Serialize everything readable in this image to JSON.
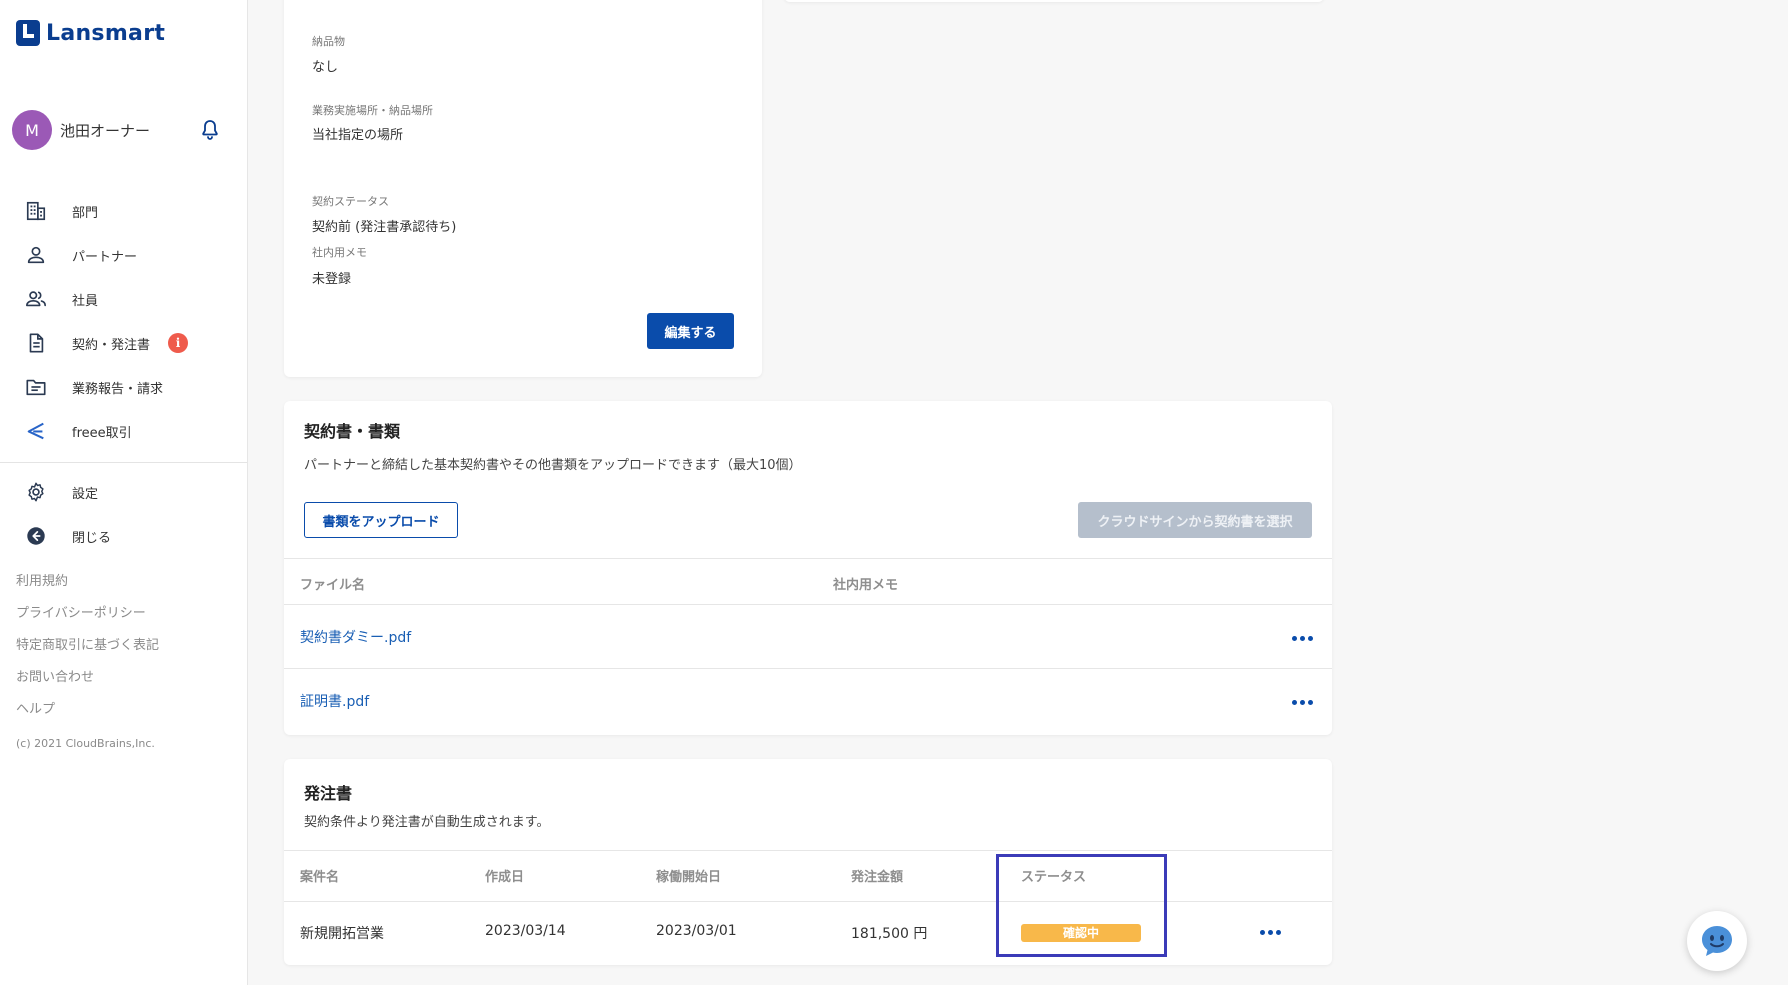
{
  "brand": {
    "name": "Lansmart",
    "color": "#0a3d8f"
  },
  "user": {
    "initial": "M",
    "name": "池田オーナー",
    "avatar_color": "#9b59b6"
  },
  "nav": {
    "items": [
      {
        "label": "部門",
        "icon": "building-icon"
      },
      {
        "label": "パートナー",
        "icon": "person-icon"
      },
      {
        "label": "社員",
        "icon": "people-icon"
      },
      {
        "label": "契約・発注書",
        "icon": "document-icon",
        "badge": "i"
      },
      {
        "label": "業務報告・請求",
        "icon": "folder-icon"
      },
      {
        "label": "freee取引",
        "icon": "freee-icon"
      }
    ],
    "secondary": [
      {
        "label": "設定",
        "icon": "gear-icon"
      },
      {
        "label": "閉じる",
        "icon": "arrow-left-circle-icon"
      }
    ]
  },
  "footer": {
    "links": [
      "利用規約",
      "プライバシーポリシー",
      "特定商取引に基づく表記",
      "お問い合わせ",
      "ヘルプ"
    ],
    "copyright": "(c) 2021 CloudBrains,Inc."
  },
  "contract_detail": {
    "deliverables_label": "納品物",
    "deliverables_value": "なし",
    "location_label": "業務実施場所・納品場所",
    "location_value": "当社指定の場所",
    "status_label": "契約ステータス",
    "status_value": "契約前 (発注書承認待ち)",
    "memo_label": "社内用メモ",
    "memo_value": "未登録",
    "edit_button": "編集する"
  },
  "documents": {
    "title": "契約書・書類",
    "description": "パートナーと締結した基本契約書やその他書類をアップロードできます（最大10個）",
    "upload_button": "書類をアップロード",
    "cloudsign_button": "クラウドサインから契約書を選択",
    "columns": {
      "file_name": "ファイル名",
      "memo": "社内用メモ"
    },
    "files": [
      {
        "name": "契約書ダミー.pdf",
        "memo": ""
      },
      {
        "name": "証明書.pdf",
        "memo": ""
      }
    ]
  },
  "purchase_orders": {
    "title": "発注書",
    "description": "契約条件より発注書が自動生成されます。",
    "columns": {
      "project": "案件名",
      "created": "作成日",
      "start": "稼働開始日",
      "amount": "発注金額",
      "status": "ステータス"
    },
    "rows": [
      {
        "project": "新規開拓営業",
        "created": "2023/03/14",
        "start": "2023/03/01",
        "amount": "181,500 円",
        "status": "確認中"
      }
    ]
  },
  "colors": {
    "primary": "#0a4cab",
    "link": "#1a5fb4",
    "status_pending": "#f8b84a",
    "highlight": "#3b3bb8",
    "badge_alert": "#ef5b4c"
  }
}
